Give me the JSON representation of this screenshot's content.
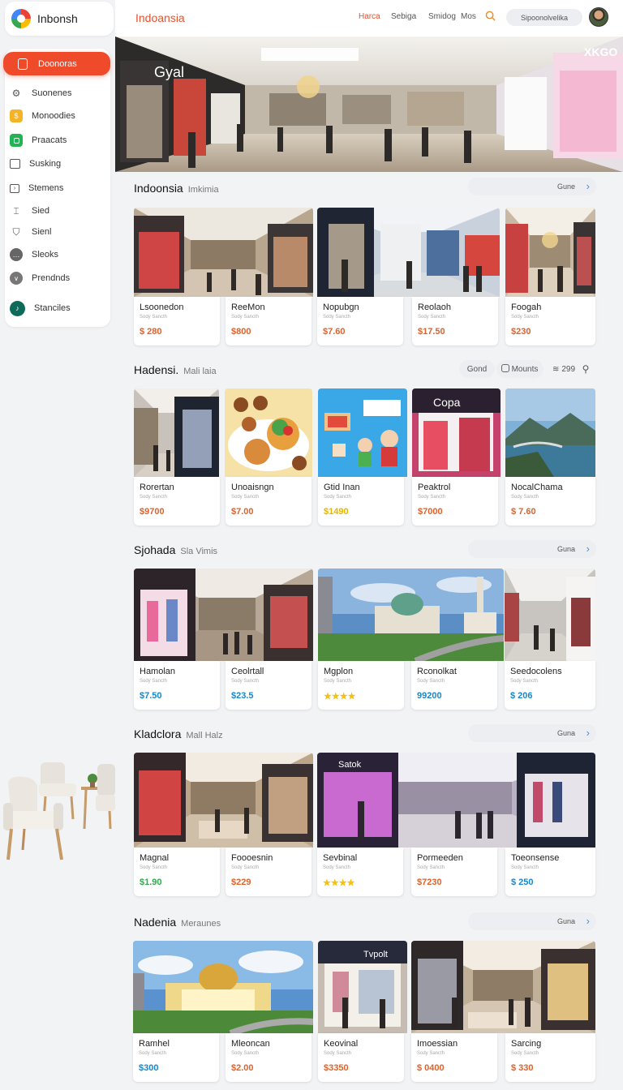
{
  "brand": {
    "name": "Inbonsh"
  },
  "sidebar": {
    "active": "Doonoras",
    "items": [
      {
        "label": "Suonenes",
        "icon": "settings-icon"
      },
      {
        "label": "Monoodies",
        "icon": "coin-icon"
      },
      {
        "label": "Praacats",
        "icon": "square-icon"
      },
      {
        "label": "Susking",
        "icon": "calendar-icon"
      },
      {
        "label": "Stemens",
        "icon": "tag-icon"
      },
      {
        "label": "Sied",
        "icon": "pin-icon"
      },
      {
        "label": "Sienl",
        "icon": "shield-icon"
      },
      {
        "label": "Sleoks",
        "icon": "chat-icon"
      },
      {
        "label": "Prendnds",
        "icon": "chevron-down-icon"
      },
      {
        "label": "Stanciles",
        "icon": "circle-icon"
      }
    ]
  },
  "header": {
    "title": "Indoansia",
    "links": [
      "Harca",
      "Sebiga",
      "Smidog",
      "Mos"
    ],
    "search_text": "Sipoonolvelika"
  },
  "sections": [
    {
      "title": "Indoonsia",
      "subtitle": "Imkimia",
      "button": "Gune",
      "cards": [
        {
          "name": "Lsoonedon",
          "small": "Sody Sancth",
          "price": "$ 280",
          "color": "#e0622a"
        },
        {
          "name": "ReeMon",
          "small": "Sody Sancth",
          "price": "$800",
          "color": "#e0622a"
        },
        {
          "name": "Nopubgn",
          "small": "Sody Sancth",
          "price": "$7.60",
          "color": "#e0622a"
        },
        {
          "name": "Reolaoh",
          "small": "Sody Sancth",
          "price": "$17.50",
          "color": "#e0622a"
        },
        {
          "name": "Foogah",
          "small": "Sody Sancth",
          "price": "$230",
          "color": "#e0622a"
        }
      ]
    },
    {
      "title": "Hadensi.",
      "subtitle": "Mali laia",
      "button": "",
      "chips": [
        "Gond",
        "Mounts",
        "299"
      ],
      "cards": [
        {
          "name": "Rorertan",
          "small": "Sody Sancth",
          "price": "$9700",
          "color": "#e0622a"
        },
        {
          "name": "Unoaisngn",
          "small": "Sody Sancth",
          "price": "$7.00",
          "color": "#e0622a"
        },
        {
          "name": "Gtid Inan",
          "small": "Sody Sancth",
          "price": "$1490",
          "color": "#e8b400"
        },
        {
          "name": "Peaktrol",
          "small": "Sody Sancth",
          "price": "$7000",
          "color": "#e0622a"
        },
        {
          "name": "NocalChama",
          "small": "Sody Sancth",
          "price": "$ 7.60",
          "color": "#e0622a"
        }
      ]
    },
    {
      "title": "Sjohada",
      "subtitle": "Sla Vimis",
      "button": "Guna",
      "cards": [
        {
          "name": "Hamolan",
          "small": "Sody Sancth",
          "price": "$7.50",
          "color": "#1a87c9"
        },
        {
          "name": "Ceolrtall",
          "small": "Sody Sancth",
          "price": "$23.5",
          "color": "#1a87c9"
        },
        {
          "name": "Mgplon",
          "small": "Sody Sancth",
          "price": "★★★★",
          "color": "#f4c10f"
        },
        {
          "name": "Rconolkat",
          "small": "Sody Sancth",
          "price": "99200",
          "color": "#1a87c9"
        },
        {
          "name": "Seedocolens",
          "small": "Sody Sancth",
          "price": "$ 206",
          "color": "#1a87c9"
        }
      ]
    },
    {
      "title": "Kladclora",
      "subtitle": "Mall Halz",
      "button": "Guna",
      "cards": [
        {
          "name": "Magnal",
          "small": "Sody Sancth",
          "price": "$1.90",
          "color": "#2eaa4a"
        },
        {
          "name": "Foooesnin",
          "small": "Sody Sancth",
          "price": "$229",
          "color": "#e0622a"
        },
        {
          "name": "Sevbinal",
          "small": "Sody Sancth",
          "price": "★★★★",
          "color": "#f4c10f"
        },
        {
          "name": "Pormeeden",
          "small": "Sody Sancth",
          "price": "$7230",
          "color": "#e0622a"
        },
        {
          "name": "Toeonsense",
          "small": "Sody Sancth",
          "price": "$ 250",
          "color": "#1a87c9"
        }
      ]
    },
    {
      "title": "Nadenia",
      "subtitle": "Meraunes",
      "button": "Guna",
      "cards": [
        {
          "name": "Ramhel",
          "small": "Sody Sancth",
          "price": "$300",
          "color": "#1a87c9"
        },
        {
          "name": "Mleoncan",
          "small": "Sody Sancth",
          "price": "$2.00",
          "color": "#e0622a"
        },
        {
          "name": "Keovinal",
          "small": "Sody Sancth",
          "price": "$3350",
          "color": "#e0622a"
        },
        {
          "name": "Imoessian",
          "small": "Sody Sancth",
          "price": "$ 0400",
          "color": "#e0622a"
        },
        {
          "name": "Sarcing",
          "small": "Sody Sancth",
          "price": "$ 330",
          "color": "#e0622a"
        }
      ]
    }
  ]
}
